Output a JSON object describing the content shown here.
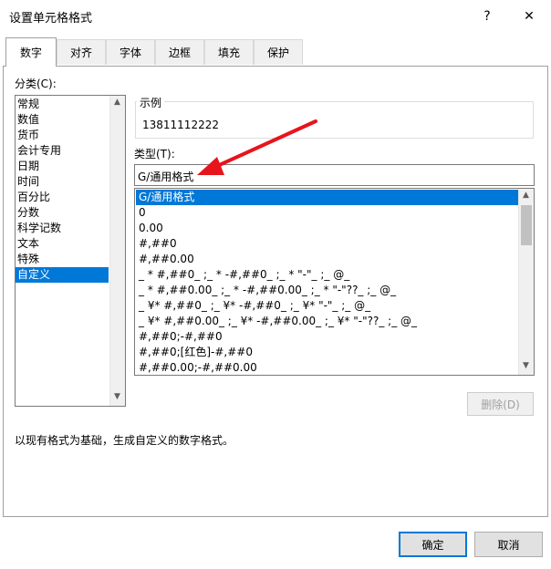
{
  "window": {
    "title": "设置单元格格式",
    "help": "?",
    "close": "✕"
  },
  "tabs": [
    "数字",
    "对齐",
    "字体",
    "边框",
    "填充",
    "保护"
  ],
  "category": {
    "label": "分类(C):",
    "items": [
      "常规",
      "数值",
      "货币",
      "会计专用",
      "日期",
      "时间",
      "百分比",
      "分数",
      "科学记数",
      "文本",
      "特殊",
      "自定义"
    ],
    "selected": "自定义"
  },
  "sample": {
    "label": "示例",
    "value": "13811112222"
  },
  "type": {
    "label": "类型(T):",
    "value": "G/通用格式",
    "items": [
      "G/通用格式",
      "0",
      "0.00",
      "#,##0",
      "#,##0.00",
      "_ * #,##0_ ;_ * -#,##0_ ;_ * \"-\"_ ;_ @_",
      "_ * #,##0.00_ ;_ * -#,##0.00_ ;_ * \"-\"??_ ;_ @_",
      "_ ¥* #,##0_ ;_ ¥* -#,##0_ ;_ ¥* \"-\"_ ;_ @_",
      "_ ¥* #,##0.00_ ;_ ¥* -#,##0.00_ ;_ ¥* \"-\"??_ ;_ @_",
      "#,##0;-#,##0",
      "#,##0;[红色]-#,##0",
      "#,##0.00;-#,##0.00"
    ],
    "selected": "G/通用格式"
  },
  "delete_button": "删除(D)",
  "description": "以现有格式为基础，生成自定义的数字格式。",
  "ok_button": "确定",
  "cancel_button": "取消",
  "colors": {
    "accent": "#0078d7",
    "annotation_arrow": "#e8141c"
  },
  "icons": {
    "scroll_up": "chevron-up-icon",
    "scroll_down": "chevron-down-icon"
  }
}
